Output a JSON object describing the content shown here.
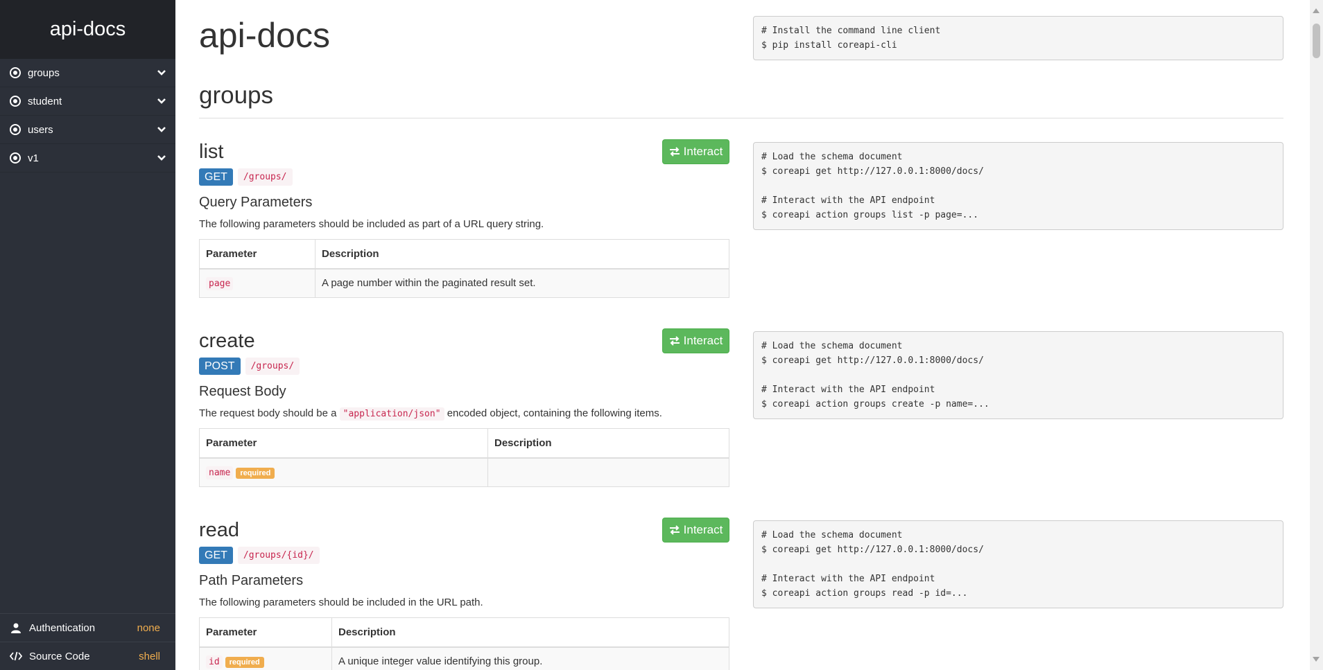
{
  "sidebar": {
    "brand": "api-docs",
    "items": [
      {
        "label": "groups"
      },
      {
        "label": "student"
      },
      {
        "label": "users"
      },
      {
        "label": "v1"
      }
    ],
    "bottom": [
      {
        "label": "Authentication",
        "value": "none",
        "icon": "user-icon"
      },
      {
        "label": "Source Code",
        "value": "shell",
        "icon": "code-icon"
      }
    ]
  },
  "main": {
    "title": "api-docs",
    "install_code": "# Install the command line client\n$ pip install coreapi-cli",
    "section": "groups",
    "interact_label": "Interact",
    "endpoints": [
      {
        "name": "list",
        "method": "GET",
        "path": "/groups/",
        "subtitle": "Query Parameters",
        "desc": "The following parameters should be included as part of a URL query string.",
        "headers": [
          "Parameter",
          "Description"
        ],
        "rows": [
          {
            "param": "page",
            "required": "",
            "desc": "A page number within the paginated result set."
          }
        ],
        "code": "# Load the schema document\n$ coreapi get http://127.0.0.1:8000/docs/\n\n# Interact with the API endpoint\n$ coreapi action groups list -p page=..."
      },
      {
        "name": "create",
        "method": "POST",
        "path": "/groups/",
        "subtitle": "Request Body",
        "desc_pre": "The request body should be a ",
        "desc_code": "\"application/json\"",
        "desc_post": " encoded object, containing the following items.",
        "headers": [
          "Parameter",
          "Description"
        ],
        "rows": [
          {
            "param": "name",
            "required": "required",
            "desc": ""
          }
        ],
        "code": "# Load the schema document\n$ coreapi get http://127.0.0.1:8000/docs/\n\n# Interact with the API endpoint\n$ coreapi action groups create -p name=..."
      },
      {
        "name": "read",
        "method": "GET",
        "path": "/groups/{id}/",
        "subtitle": "Path Parameters",
        "desc": "The following parameters should be included in the URL path.",
        "headers": [
          "Parameter",
          "Description"
        ],
        "rows": [
          {
            "param": "id",
            "required": "required",
            "desc": "A unique integer value identifying this group."
          }
        ],
        "code": "# Load the schema document\n$ coreapi get http://127.0.0.1:8000/docs/\n\n# Interact with the API endpoint\n$ coreapi action groups read -p id=..."
      }
    ]
  },
  "colors": {
    "sidebar_bg": "#2c3039",
    "brand_bg": "#212328",
    "interact_green": "#5cb85c",
    "method_blue": "#337ab7",
    "required_orange": "#f0ad4e",
    "code_red": "#c7254e"
  }
}
